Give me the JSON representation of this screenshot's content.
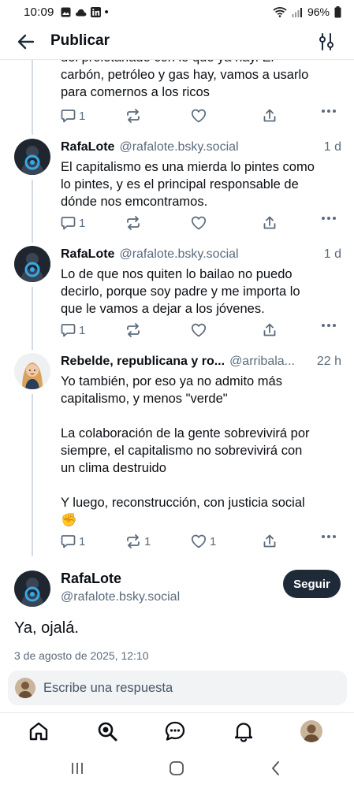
{
  "status_bar": {
    "time": "10:09",
    "dot": "•",
    "battery": "96%"
  },
  "header": {
    "title": "Publicar"
  },
  "thread": [
    {
      "text": "del proletariado con lo que ya hay. El\ncarbón, petróleo y gas hay, vamos a usarlo\npara comernos a los ricos",
      "replies": "1",
      "reposts": "",
      "likes": ""
    },
    {
      "author": "RafaLote",
      "handle": "@rafalote.bsky.social",
      "time": "1 d",
      "text": "El capitalismo es una mierda lo pintes como\nlo pintes, y es el principal responsable de\ndónde nos emcontramos.",
      "replies": "1",
      "reposts": "",
      "likes": ""
    },
    {
      "author": "RafaLote",
      "handle": "@rafalote.bsky.social",
      "time": "1 d",
      "text": "Lo de que nos quiten lo bailao no puedo\ndecirlo, porque soy padre y me importa lo\nque le vamos a dejar a los jóvenes.",
      "replies": "1",
      "reposts": "",
      "likes": ""
    },
    {
      "author": "Rebelde, republicana y ro...",
      "handle": "@arribala...",
      "time": "22 h",
      "text": "Yo también, por eso ya no admito más\ncapitalismo, y menos \"verde\"\n\nLa colaboración de la gente sobrevivirá por\nsiempre, el capitalismo no sobrevivirá con\nun clima destruido\n\nY luego, reconstrucción, con justicia social\n✊",
      "replies": "1",
      "reposts": "1",
      "likes": "1"
    }
  ],
  "main_post": {
    "author": "RafaLote",
    "handle": "@rafalote.bsky.social",
    "follow_label": "Seguir",
    "text": "Ya, ojalá.",
    "date": "3 de agosto de 2025, 12:10"
  },
  "composer": {
    "placeholder": "Escribe una respuesta"
  },
  "colors": {
    "accent": "#1e2a38",
    "secondary_text": "#5b6b7c",
    "thread_line": "#d4dbe2"
  }
}
